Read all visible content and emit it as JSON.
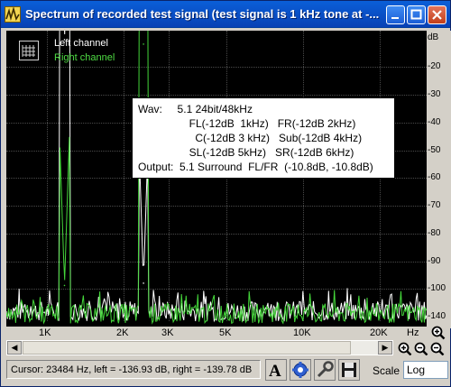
{
  "window": {
    "title": "Spectrum of recorded test signal (test signal is 1 kHz tone at -..."
  },
  "legend": {
    "left": "Left channel",
    "right": "Right channel"
  },
  "info": {
    "text": "Wav:     5.1 24bit/48kHz\n                 FL(-12dB  1kHz)   FR(-12dB 2kHz)\n                   C(-12dB 3 kHz)   Sub(-12dB 4kHz)\n                 SL(-12dB 5kHz)   SR(-12dB 6kHz)\nOutput:  5.1 Surround  FL/FR  (-10.8dB, -10.8dB)"
  },
  "yaxis": {
    "unit": "dB",
    "ticks": [
      "-20",
      "-30",
      "-40",
      "-50",
      "-60",
      "-70",
      "-80",
      "-90",
      "-100",
      "-110",
      "-120",
      "-130",
      "-140"
    ]
  },
  "xaxis": {
    "ticks": [
      "1K",
      "2K",
      "3K",
      "5K",
      "10K",
      "20K"
    ],
    "unit": "Hz"
  },
  "status": {
    "cursor": "Cursor:  23484 Hz,  left = -136.93 dB,  right = -139.78 dB",
    "scale_label": "Scale",
    "scale_value": "Log"
  },
  "colors": {
    "left_channel": "#ffffff",
    "right_channel": "#44d63a",
    "plot_bg": "#000000"
  },
  "chart_data": {
    "type": "line",
    "xscale": "log",
    "xlim_hz": [
      600,
      24000
    ],
    "ylim": [
      -140,
      -10
    ],
    "series": [
      {
        "name": "Left channel",
        "peaks": [
          {
            "x_hz": 1000,
            "y": -14
          },
          {
            "x_hz": 2000,
            "y": -123
          }
        ],
        "noise_floor": -136
      },
      {
        "name": "Right channel",
        "peaks": [
          {
            "x_hz": 2000,
            "y": -16
          },
          {
            "x_hz": 1000,
            "y": -124
          }
        ],
        "noise_floor": -137
      }
    ]
  }
}
